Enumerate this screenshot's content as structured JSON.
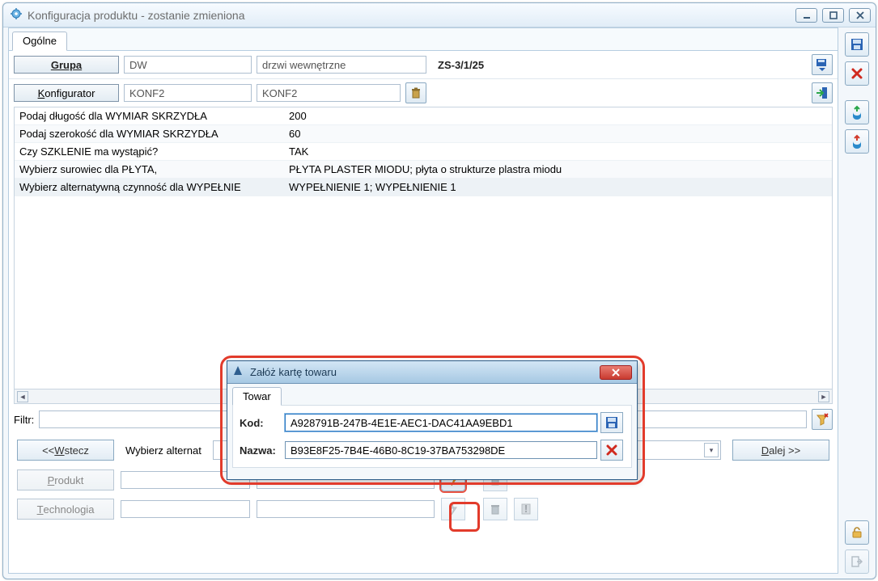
{
  "window": {
    "title": "Konfiguracja produktu - zostanie zmieniona"
  },
  "tabs": {
    "general": "Ogólne"
  },
  "header": {
    "group_btn": "Grupa",
    "group_code": "DW",
    "group_name": "drzwi wewnętrzne",
    "doc_no": "ZS-3/1/25",
    "konfig_btn": "Konfigurator",
    "konfig_code": "KONF2",
    "konfig_name": "KONF2"
  },
  "grid": [
    {
      "p": "Podaj długość dla WYMIAR SKRZYDŁA",
      "v": "200"
    },
    {
      "p": "Podaj szerokość dla WYMIAR SKRZYDŁA",
      "v": "60"
    },
    {
      "p": "Czy SZKLENIE ma wystąpić?",
      "v": "TAK"
    },
    {
      "p": "Wybierz surowiec dla PŁYTA,",
      "v": "PŁYTA PLASTER MIODU; płyta o strukturze plastra miodu"
    },
    {
      "p": "Wybierz alternatywną czynność dla WYPEŁNIE",
      "v": "WYPEŁNIENIE 1; WYPEŁNIENIE 1"
    }
  ],
  "filter_label": "Filtr:",
  "nav": {
    "back": "<< Wstecz",
    "next": "Dalej >>",
    "prompt": "Wybierz alternat"
  },
  "bottom": {
    "product": "Produkt",
    "tech": "Technologia"
  },
  "dialog": {
    "title": "Załóż kartę towaru",
    "tab": "Towar",
    "kod_label": "Kod:",
    "kod_value": "A928791B-247B-4E1E-AEC1-DAC41AA9EBD1",
    "nazwa_label": "Nazwa:",
    "nazwa_value": "B93E8F25-7B4E-46B0-8C19-37BA753298DE"
  },
  "icons": {
    "gear": "gear-icon",
    "min": "minimize-icon",
    "max": "maximize-icon",
    "close": "close-icon",
    "save": "save-icon",
    "delete": "delete-icon",
    "bucket-up": "import-icon",
    "bucket-down": "export-icon",
    "lock": "lock-icon",
    "exit": "exit-icon",
    "trash": "trash-icon",
    "arrow-in": "arrow-in-icon",
    "arrow-drop": "dropdown-icon",
    "wand": "wand-icon",
    "bolt": "bolt-icon",
    "warn": "warn-icon"
  }
}
